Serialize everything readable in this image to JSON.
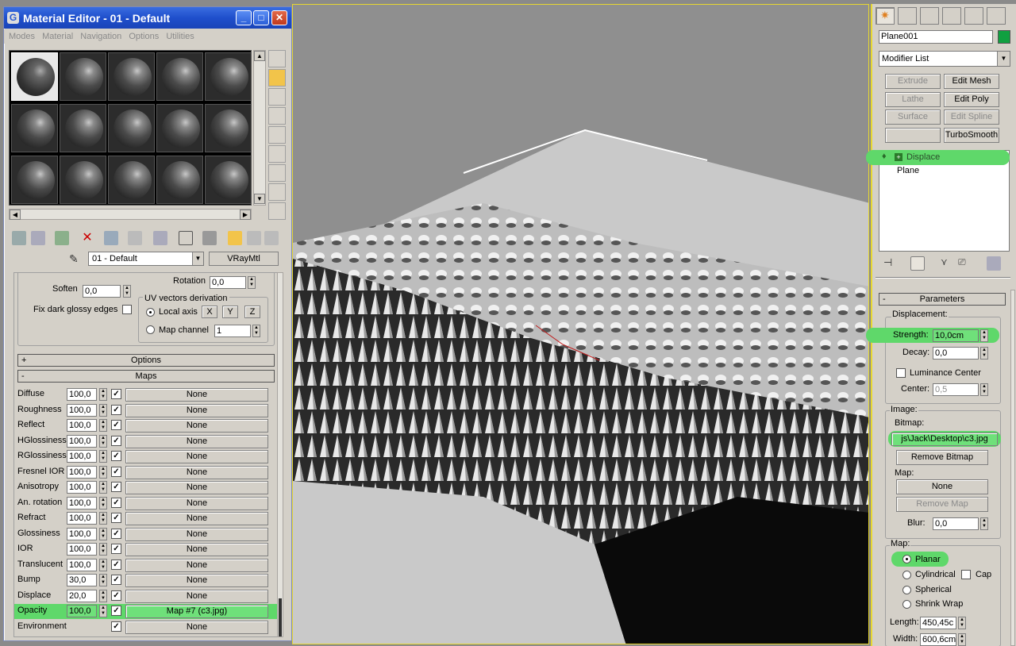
{
  "material_editor": {
    "title": "Material Editor - 01 - Default",
    "menu": [
      "Modes",
      "Material",
      "Navigation",
      "Options",
      "Utilities"
    ],
    "material_name": "01 - Default",
    "material_type": "VRayMtl",
    "soften_label": "Soften",
    "soften_value": "0,0",
    "rotation_label": "Rotation",
    "rotation_value": "0,0",
    "fix_dark_label": "Fix dark glossy edges",
    "uv_group": "UV vectors derivation",
    "local_axis": "Local axis",
    "axis_x": "X",
    "axis_y": "Y",
    "axis_z": "Z",
    "map_channel": "Map channel",
    "map_channel_value": "1",
    "options_rollout": "Options",
    "maps_rollout": "Maps",
    "options_sign": "+",
    "maps_sign": "-",
    "maps": [
      {
        "name": "Diffuse",
        "value": "100,0",
        "map": "None"
      },
      {
        "name": "Roughness",
        "value": "100,0",
        "map": "None"
      },
      {
        "name": "Reflect",
        "value": "100,0",
        "map": "None"
      },
      {
        "name": "HGlossiness",
        "value": "100,0",
        "map": "None"
      },
      {
        "name": "RGlossiness",
        "value": "100,0",
        "map": "None"
      },
      {
        "name": "Fresnel IOR",
        "value": "100,0",
        "map": "None"
      },
      {
        "name": "Anisotropy",
        "value": "100,0",
        "map": "None"
      },
      {
        "name": "An. rotation",
        "value": "100,0",
        "map": "None"
      },
      {
        "name": "Refract",
        "value": "100,0",
        "map": "None"
      },
      {
        "name": "Glossiness",
        "value": "100,0",
        "map": "None"
      },
      {
        "name": "IOR",
        "value": "100,0",
        "map": "None"
      },
      {
        "name": "Translucent",
        "value": "100,0",
        "map": "None"
      },
      {
        "name": "Bump",
        "value": "30,0",
        "map": "None"
      },
      {
        "name": "Displace",
        "value": "20,0",
        "map": "None"
      },
      {
        "name": "Opacity",
        "value": "100,0",
        "map": "Map #7 (c3.jpg)"
      },
      {
        "name": "Environment",
        "value": "",
        "map": "None"
      }
    ]
  },
  "command_panel": {
    "object_name": "Plane001",
    "modifier_list": "Modifier List",
    "buttons": [
      {
        "label": "Extrude",
        "enabled": false
      },
      {
        "label": "Edit Mesh",
        "enabled": true
      },
      {
        "label": "Lathe",
        "enabled": false
      },
      {
        "label": "Edit Poly",
        "enabled": true
      },
      {
        "label": "Surface",
        "enabled": false
      },
      {
        "label": "Edit Spline",
        "enabled": false
      },
      {
        "label": "",
        "enabled": false
      },
      {
        "label": "TurboSmooth",
        "enabled": true
      }
    ],
    "stack": [
      "Displace",
      "Plane"
    ],
    "parameters": {
      "rollout": "Parameters",
      "rollout_sign": "-",
      "displacement_group": "Displacement:",
      "strength_label": "Strength:",
      "strength_value": "10,0cm",
      "decay_label": "Decay:",
      "decay_value": "0,0",
      "luminance_center": "Luminance Center",
      "center_label": "Center:",
      "center_value": "0,5",
      "image_group": "Image:",
      "bitmap_label": "Bitmap:",
      "bitmap_value": "js\\Jack\\Desktop\\c3.jpg",
      "remove_bitmap": "Remove Bitmap",
      "map_label": "Map:",
      "map_value": "None",
      "remove_map": "Remove Map",
      "blur_label": "Blur:",
      "blur_value": "0,0",
      "map_group": "Map:",
      "planar": "Planar",
      "cylindrical": "Cylindrical",
      "cap": "Cap",
      "spherical": "Spherical",
      "shrink_wrap": "Shrink Wrap",
      "length_label": "Length:",
      "length_value": "450,45c",
      "width_label": "Width:",
      "width_value": "600,6cm"
    }
  },
  "colors": {
    "highlight": "#5fd86a",
    "title_bar": "#1f4fcc",
    "object_color": "#10a040",
    "viewport_border": "#e8d830"
  }
}
